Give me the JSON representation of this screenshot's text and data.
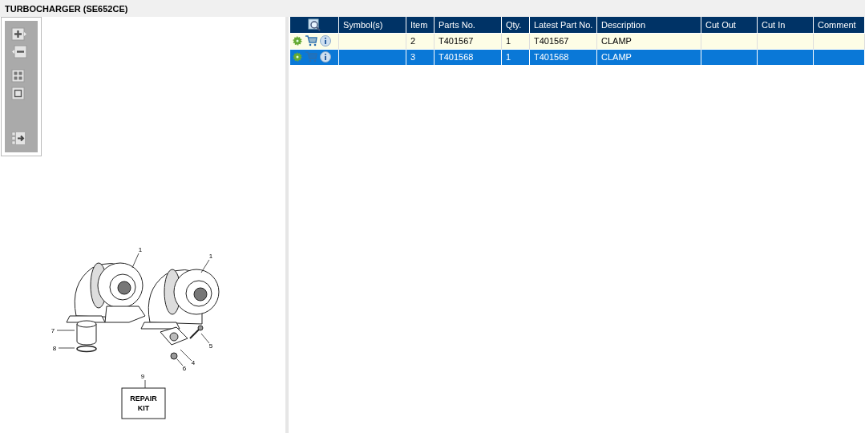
{
  "title": "TURBOCHARGER (SE652CE)",
  "diagram": {
    "callouts": [
      "1",
      "1",
      "7",
      "8",
      "5",
      "4",
      "6",
      "9"
    ],
    "kit_label": "REPAIR KIT"
  },
  "table": {
    "columns": [
      "Symbol(s)",
      "Item",
      "Parts No.",
      "Qty.",
      "Latest Part No.",
      "Description",
      "Cut Out",
      "Cut In",
      "Comment"
    ],
    "rows": [
      {
        "item": "2",
        "parts_no": "T401567",
        "qty": "1",
        "latest_part_no": "T401567",
        "description": "CLAMP",
        "selected": false
      },
      {
        "item": "3",
        "parts_no": "T401568",
        "qty": "1",
        "latest_part_no": "T401568",
        "description": "CLAMP",
        "selected": true
      }
    ]
  }
}
